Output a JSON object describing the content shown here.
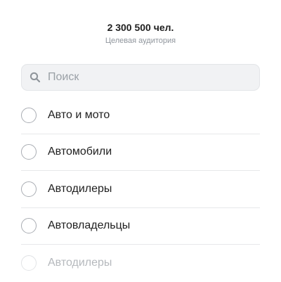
{
  "audience": {
    "count": "2 300 500 чел.",
    "label": "Целевая аудитория"
  },
  "search": {
    "placeholder": "Поиск",
    "value": "",
    "icon": "search-icon"
  },
  "list": {
    "items": [
      {
        "label": "Авто и мото",
        "selected": false
      },
      {
        "label": "Автомобили",
        "selected": false
      },
      {
        "label": "Автодилеры",
        "selected": false
      },
      {
        "label": "Автовладельцы",
        "selected": false
      },
      {
        "label": "Автодилеры",
        "selected": false
      }
    ]
  },
  "colors": {
    "text": "#1f1f1f",
    "muted": "#8f959c",
    "search_bg": "#f1f2f4",
    "radio_border": "#a9adb3",
    "divider": "#e7e8ea"
  }
}
